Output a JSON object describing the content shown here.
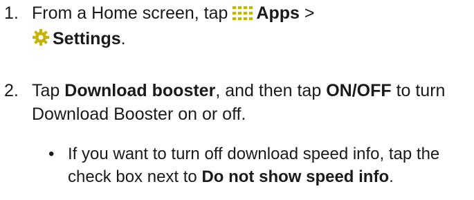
{
  "steps": [
    {
      "number": "1.",
      "parts": {
        "a": "From a Home screen, tap ",
        "apps": "Apps",
        "b": " >",
        "settings": "Settings",
        "c": "."
      }
    },
    {
      "number": "2.",
      "parts": {
        "a": "Tap ",
        "download_booster": "Download booster",
        "b": ", and then tap ",
        "onoff": "ON/OFF",
        "c": " to turn Download Booster on or off."
      }
    }
  ],
  "bullet": {
    "symbol": "•",
    "parts": {
      "a": "If you want to turn off download speed info, tap the check box next to ",
      "do_not_show": "Do not show speed info",
      "b": "."
    }
  },
  "icons": {
    "apps": "apps-grid-icon",
    "settings": "settings-gear-icon"
  },
  "colors": {
    "text": "#1a1a1a",
    "apps_icon": "#c8b400",
    "settings_icon": "#c8b400"
  }
}
